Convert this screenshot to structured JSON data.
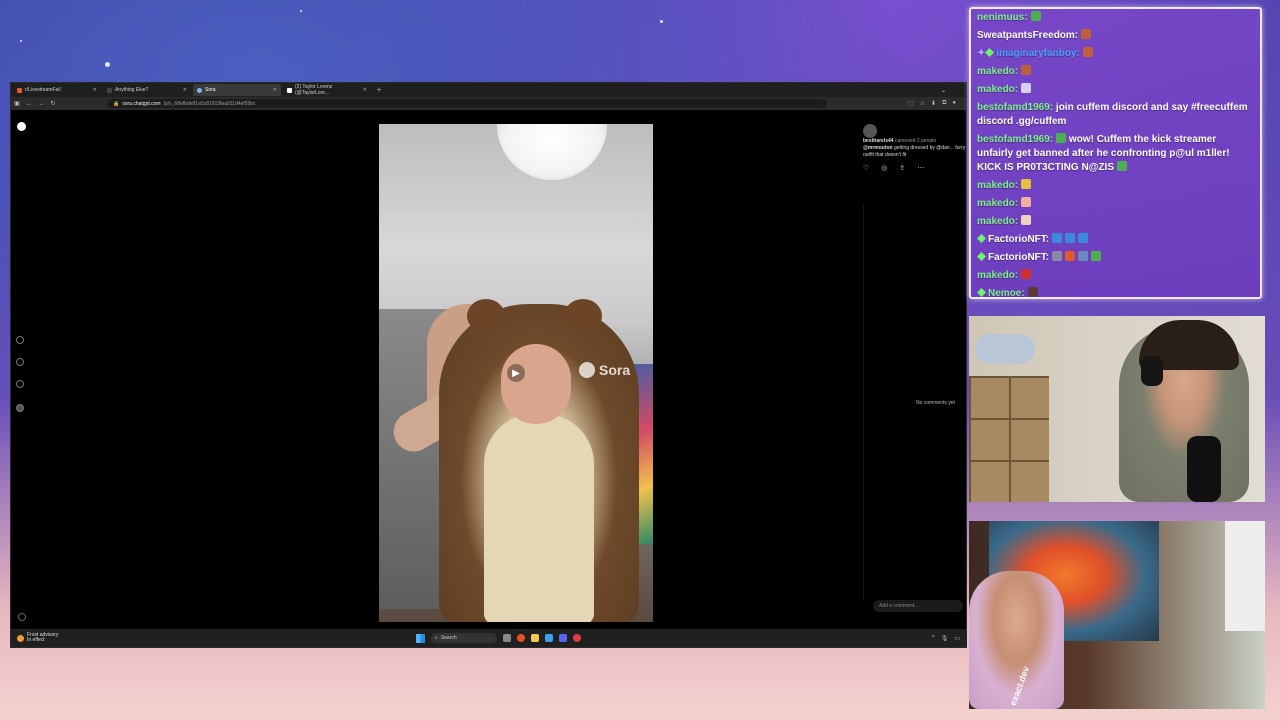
{
  "browser": {
    "tabs": [
      {
        "label": "r/LivestreamFail",
        "active": false
      },
      {
        "label": "Anything Else?",
        "active": false
      },
      {
        "label": "Sora",
        "active": true
      },
      {
        "label": "(2) Taylor Lorenz (@TaylorLore...",
        "active": false
      }
    ],
    "url_host": "sora.chatgpt.com",
    "url_path": "/p/s_68efbde91a5c81919faa911d4ef59bc"
  },
  "sora": {
    "watermark": "Sora",
    "post": {
      "author": "bestharels44",
      "meta": "cameoed 2 people",
      "caption_user": "@mrmouton",
      "caption": "getting dressed by @dan... furry outfit that doesn't fit"
    },
    "no_comments": "No comments yet",
    "add_comment_placeholder": "Add a comment..."
  },
  "taskbar": {
    "weather_line1": "Frost advisory",
    "weather_line2": "In effect",
    "search_placeholder": "Search"
  },
  "chat": {
    "messages": [
      {
        "user": "nenimuus:",
        "text": "",
        "color": "green"
      },
      {
        "user": "SweatpantsFreedom:",
        "text": "",
        "color": "white"
      },
      {
        "user": "imaginaryfanboy:",
        "text": "",
        "color": "blue"
      },
      {
        "user": "makedo:",
        "text": "",
        "color": "green"
      },
      {
        "user": "makedo:",
        "text": "",
        "color": "green"
      },
      {
        "user": "bestofamd1969:",
        "text": "join cuffem discord and say #freecuffem discord .gg/cuffem",
        "color": "green"
      },
      {
        "user": "bestofamd1969:",
        "text": "wow! Cuffem the kick streamer unfairly get banned after he confronting p@ul m1ller! KICK IS PR0T3CTING N@ZIS",
        "color": "green"
      },
      {
        "user": "makedo:",
        "text": "",
        "color": "green"
      },
      {
        "user": "makedo:",
        "text": "",
        "color": "green"
      },
      {
        "user": "makedo:",
        "text": "",
        "color": "green"
      },
      {
        "user": "FactorioNFT:",
        "text": "",
        "color": "white"
      },
      {
        "user": "FactorioNFT:",
        "text": "",
        "color": "white"
      },
      {
        "user": "makedo:",
        "text": "",
        "color": "green"
      },
      {
        "user": "Nemoe:",
        "text": "",
        "color": "green"
      }
    ]
  },
  "webcam2": {
    "shirt_logo": "exact.dev"
  }
}
